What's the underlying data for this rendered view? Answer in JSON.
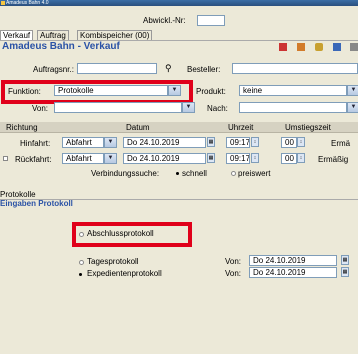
{
  "window": {
    "title": "Amadeus Bahn 4.0"
  },
  "top": {
    "abwickl_label": "Abwickl.-Nr:",
    "abwickl_value": ""
  },
  "tabs": [
    {
      "label": "Verkauf"
    },
    {
      "label": "Auftrag"
    },
    {
      "label": "Kombispeicher (00)"
    }
  ],
  "header": {
    "title": "Amadeus Bahn - Verkauf"
  },
  "order": {
    "auftragsnr_label": "Auftragsnr.:",
    "auftragsnr_value": "",
    "besteller_label": "Besteller:",
    "besteller_value": ""
  },
  "funktion": {
    "label": "Funktion:",
    "value": "Protokolle"
  },
  "produkt": {
    "label": "Produkt:",
    "value": "keine"
  },
  "von": {
    "label": "Von:",
    "value": ""
  },
  "nach": {
    "label": "Nach:",
    "value": ""
  },
  "columns": {
    "richtung": "Richtung",
    "datum": "Datum",
    "uhrzeit": "Uhrzeit",
    "umstieg": "Umstiegszeit"
  },
  "hinfahrt": {
    "label": "Hinfahrt:",
    "richtung": "Abfahrt",
    "datum": "Do 24.10.2019",
    "uhrzeit": "09:17",
    "umstieg": "00",
    "extra": "Ermä"
  },
  "rueckfahrt": {
    "label": "Rückfahrt:",
    "richtung": "Abfahrt",
    "datum": "Do 24.10.2019",
    "uhrzeit": "09:17",
    "umstieg": "00",
    "extra": "Ermäßig"
  },
  "suche": {
    "label": "Verbindungssuche:",
    "opt1": "schnell",
    "opt2": "preiswert"
  },
  "section": {
    "tab": "Protokolle",
    "title": "Eingaben Protokoll"
  },
  "protokoll": {
    "abschluss": "Abschlussprotokoll",
    "tages": "Tagesprotokoll",
    "expedienten": "Expedientenprotokoll",
    "von_label": "Von:",
    "tages_date": "Do 24.10.2019",
    "exp_date": "Do 24.10.2019"
  },
  "colors": {
    "accent": "#2a52a6",
    "highlight": "#e0001a"
  }
}
